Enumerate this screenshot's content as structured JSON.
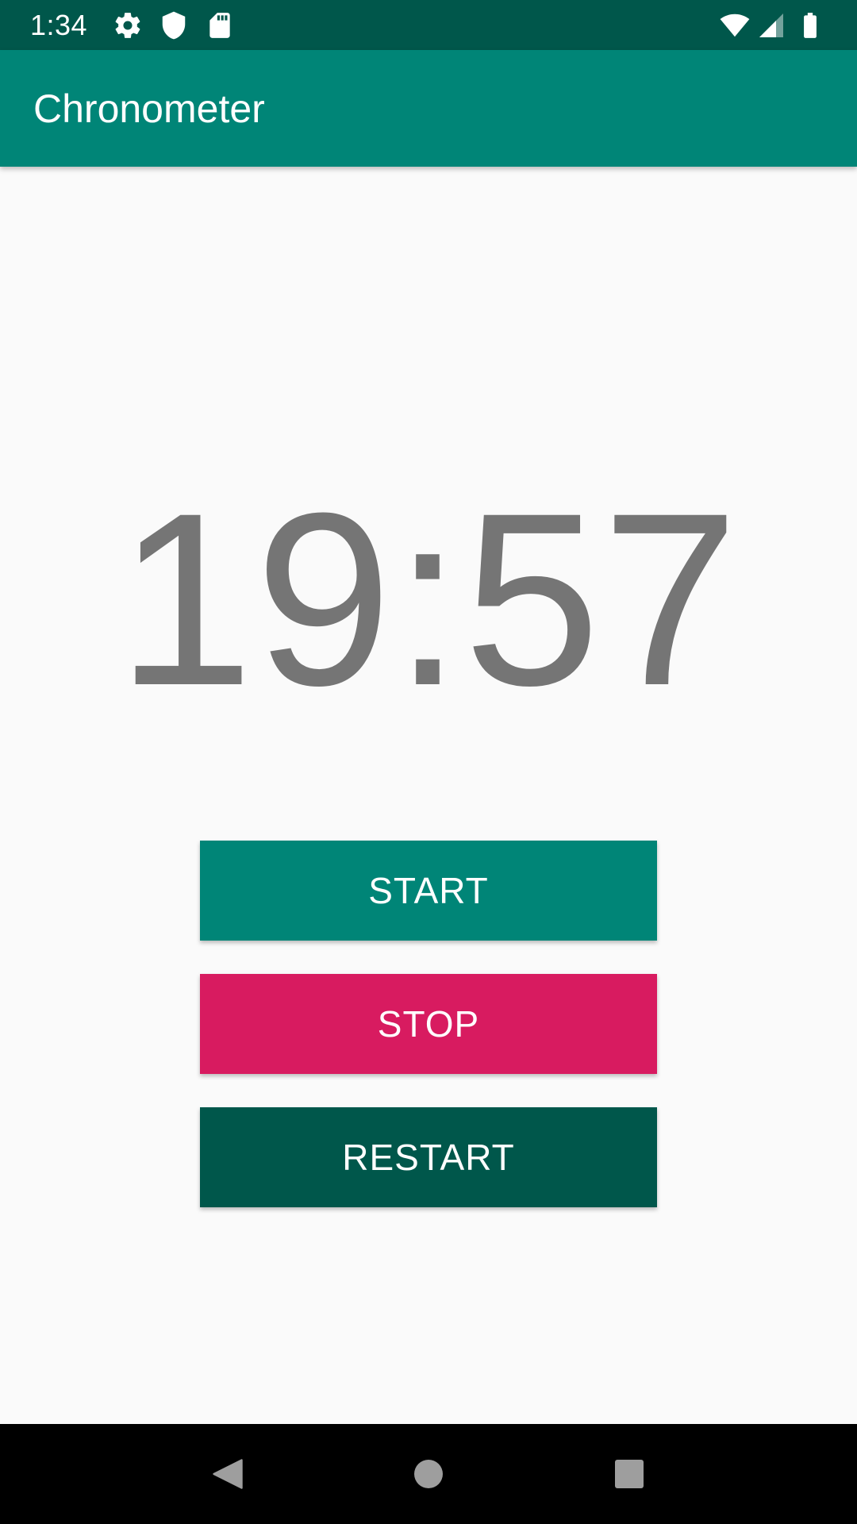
{
  "status_bar": {
    "time": "1:34",
    "left_icons": [
      "gear-icon",
      "shield-icon",
      "sd-card-icon"
    ],
    "right_icons": [
      "wifi-icon",
      "cell-signal-icon",
      "battery-icon"
    ]
  },
  "app_bar": {
    "title": "Chronometer",
    "color": "#008577"
  },
  "chronometer": {
    "value": "19:57",
    "color": "#757575"
  },
  "buttons": {
    "start": {
      "label": "START",
      "color": "#008577"
    },
    "stop": {
      "label": "STOP",
      "color": "#d81b60"
    },
    "restart": {
      "label": "RESTART",
      "color": "#00574b"
    }
  },
  "nav_bar": {
    "icons": [
      "back-icon",
      "home-icon",
      "recents-icon"
    ]
  }
}
